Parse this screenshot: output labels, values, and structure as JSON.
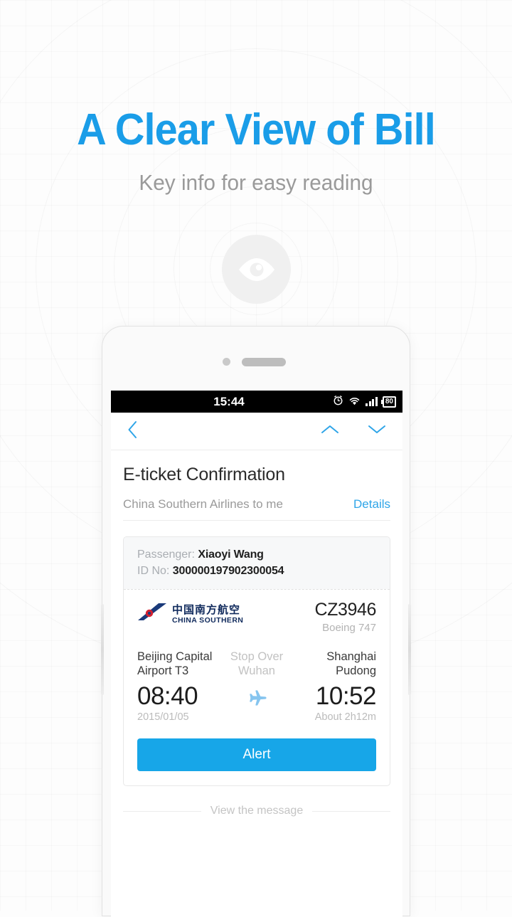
{
  "hero": {
    "headline": "A Clear View of Bill",
    "subhead": "Key info for easy reading",
    "eye_icon": "eye-icon",
    "accent_color": "#1a9de8",
    "subhead_color": "#9a9a9a"
  },
  "phone": {
    "statusbar": {
      "time": "15:44",
      "alarm_icon": "alarm-clock-icon",
      "wifi_icon": "wifi-icon",
      "signal_icon": "signal-bars-icon",
      "battery_level": "80",
      "background": "#000000"
    },
    "navbar": {
      "back_icon": "chevron-left-icon",
      "prev_icon": "chevron-up-icon",
      "next_icon": "chevron-down-icon",
      "icon_color": "#2fa5e8"
    },
    "mail": {
      "subject": "E-ticket Confirmation",
      "from": "China Southern Airlines to me",
      "details_label": "Details",
      "view_message_label": "View the message"
    },
    "ticket": {
      "passenger_label": "Passenger:",
      "passenger_name": "Xiaoyi Wang",
      "id_label": "ID No:",
      "id_number": "300000197902300054",
      "airline_cn": "中国南方航空",
      "airline_en": "CHINA SOUTHERN",
      "airline_logo_icon": "china-southern-tailfin-icon",
      "flight_number": "CZ3946",
      "aircraft": "Boeing 747",
      "departure_airport": "Beijing Capital Airport T3",
      "departure_time": "08:40",
      "departure_date": "2015/01/05",
      "stopover_label": "Stop Over",
      "stopover_city": "Wuhan",
      "plane_icon": "airplane-icon",
      "arrival_airport": "Shanghai Pudong",
      "arrival_time": "10:52",
      "duration": "About 2h12m",
      "alert_button_label": "Alert",
      "alert_button_color": "#17a6e8"
    }
  }
}
